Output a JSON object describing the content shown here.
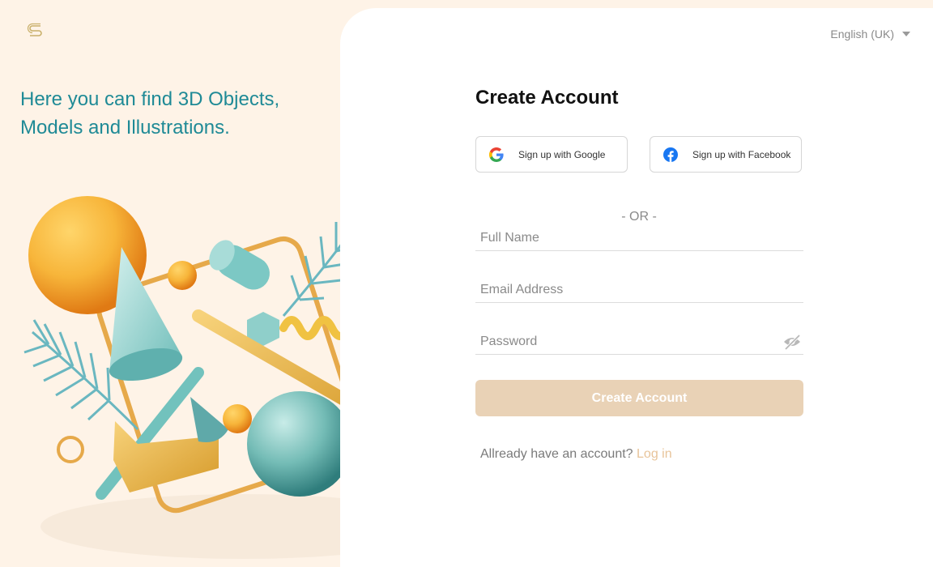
{
  "brand": {
    "logo_icon": "brand-s-logo-icon",
    "accent": "#c9b06b"
  },
  "hero": {
    "tagline": "Here you can find 3D Objects, Models and Illustrations."
  },
  "language": {
    "selected": "English (UK)",
    "icon": "chevron-down-icon"
  },
  "form": {
    "title": "Create Account",
    "google_label": "Sign up with Google",
    "facebook_label": "Sign up with Facebook",
    "separator": "- OR -",
    "full_name_placeholder": "Full Name",
    "email_placeholder": "Email Address",
    "password_placeholder": "Password",
    "password_toggle_icon": "eye-off-icon",
    "submit_label": "Create Account",
    "login_prompt": "Allready have an account?",
    "login_link": "Log in"
  },
  "colors": {
    "left_bg": "#fef3e7",
    "tagline": "#1f8a96",
    "button_bg": "#e9d2b6",
    "link": "#e8c49a"
  }
}
